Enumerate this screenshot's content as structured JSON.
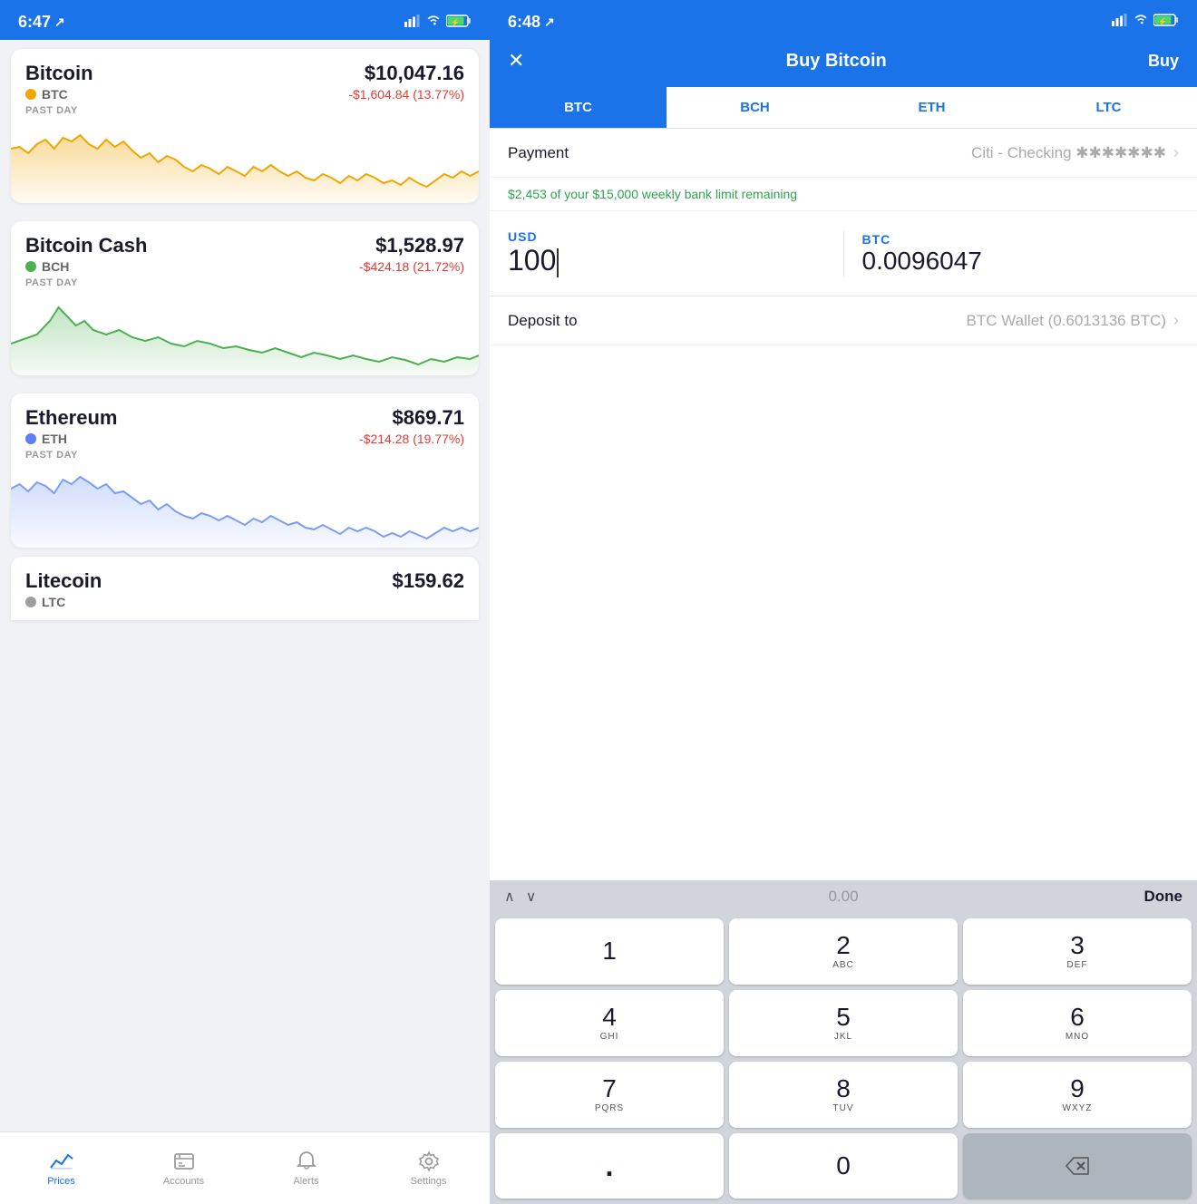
{
  "left": {
    "status": {
      "time": "6:47",
      "location_icon": "arrow-up-right",
      "signal": "●●●●",
      "wifi": "wifi",
      "battery": "battery-charging"
    },
    "coins": [
      {
        "name": "Bitcoin",
        "ticker": "BTC",
        "dot_color": "#f0a500",
        "price": "$10,047.16",
        "change": "-$1,604.84 (13.77%)",
        "past_day": "PAST DAY",
        "chart_color": "#f0a500",
        "chart_fill": "#fef3cd"
      },
      {
        "name": "Bitcoin Cash",
        "ticker": "BCH",
        "dot_color": "#4caf50",
        "price": "$1,528.97",
        "change": "-$424.18 (21.72%)",
        "past_day": "PAST DAY",
        "chart_color": "#4caf50",
        "chart_fill": "#e8f5e9"
      },
      {
        "name": "Ethereum",
        "ticker": "ETH",
        "dot_color": "#5c7cfa",
        "price": "$869.71",
        "change": "-$214.28 (19.77%)",
        "past_day": "PAST DAY",
        "chart_color": "#7b9cf5",
        "chart_fill": "#e8eeff"
      },
      {
        "name": "Litecoin",
        "ticker": "LTC",
        "dot_color": "#9e9e9e",
        "price": "$159.62",
        "change": "",
        "partial": true
      }
    ],
    "nav": [
      {
        "id": "prices",
        "label": "Prices",
        "active": true
      },
      {
        "id": "accounts",
        "label": "Accounts",
        "active": false
      },
      {
        "id": "alerts",
        "label": "Alerts",
        "active": false
      },
      {
        "id": "settings",
        "label": "Settings",
        "active": false
      }
    ]
  },
  "right": {
    "status": {
      "time": "6:48",
      "location_icon": "arrow-up-right"
    },
    "header": {
      "close_label": "✕",
      "title": "Buy Bitcoin",
      "action_label": "Buy"
    },
    "tabs": [
      {
        "id": "BTC",
        "label": "BTC",
        "active": true
      },
      {
        "id": "BCH",
        "label": "BCH",
        "active": false
      },
      {
        "id": "ETH",
        "label": "ETH",
        "active": false
      },
      {
        "id": "LTC",
        "label": "LTC",
        "active": false
      }
    ],
    "payment": {
      "label": "Payment",
      "value": "Citi - Checking ✱✱✱✱✱✱✱"
    },
    "limit_text": "$2,453 of your $15,000 weekly bank limit remaining",
    "usd": {
      "currency": "USD",
      "amount": "100"
    },
    "btc": {
      "currency": "BTC",
      "amount": "0.0096047"
    },
    "deposit": {
      "label": "Deposit to",
      "value": "BTC Wallet (0.6013136 BTC)"
    },
    "keyboard_toolbar": {
      "amount": "0.00",
      "done_label": "Done"
    },
    "keyboard": [
      {
        "number": "1",
        "letters": ""
      },
      {
        "number": "2",
        "letters": "ABC"
      },
      {
        "number": "3",
        "letters": "DEF"
      },
      {
        "number": "4",
        "letters": "GHI"
      },
      {
        "number": "5",
        "letters": "JKL"
      },
      {
        "number": "6",
        "letters": "MNO"
      },
      {
        "number": "7",
        "letters": "PQRS"
      },
      {
        "number": "8",
        "letters": "TUV"
      },
      {
        "number": "9",
        "letters": "WXYZ"
      },
      {
        "number": ".",
        "letters": "",
        "type": "dot"
      },
      {
        "number": "0",
        "letters": "",
        "type": "zero"
      },
      {
        "number": "⌫",
        "letters": "",
        "type": "delete"
      }
    ]
  }
}
